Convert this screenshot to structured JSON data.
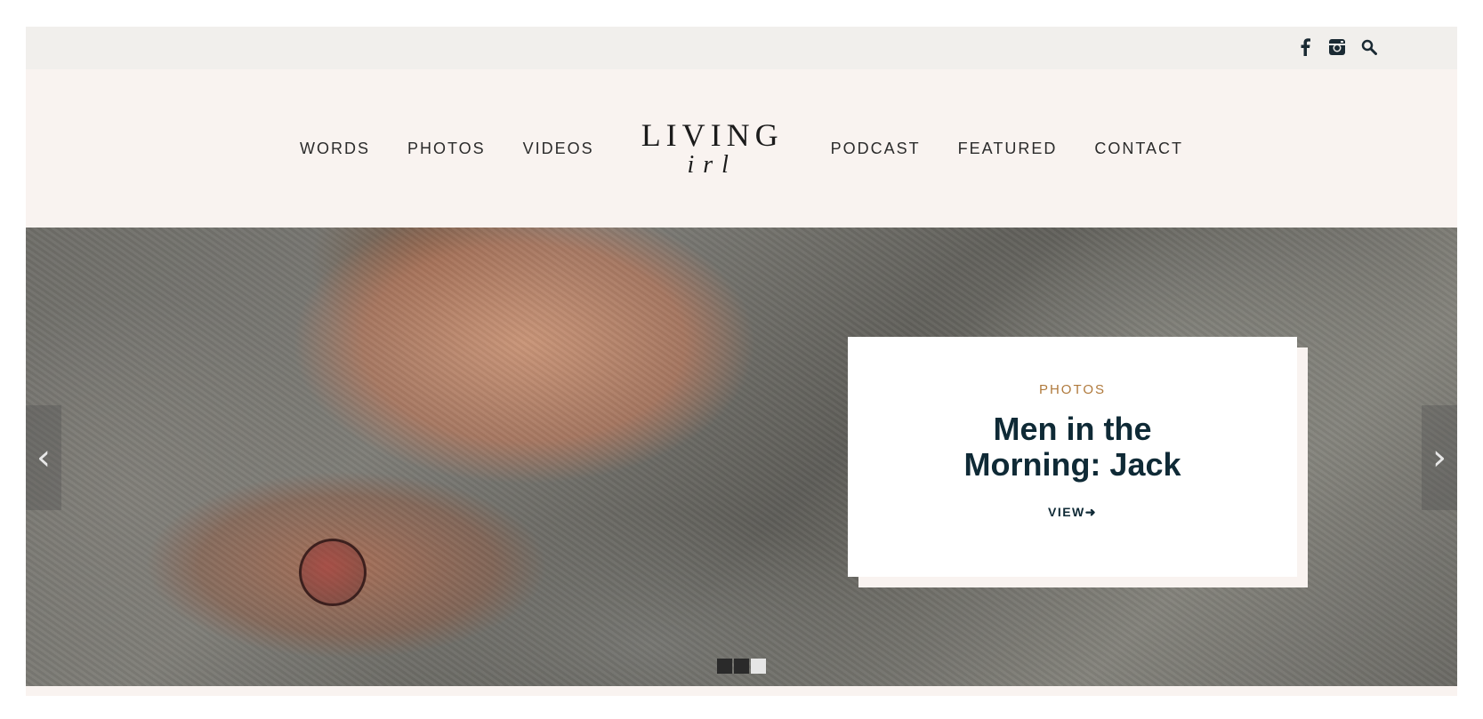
{
  "social": {
    "icons": [
      "facebook-icon",
      "instagram-icon",
      "search-icon"
    ]
  },
  "nav": {
    "left": [
      "WORDS",
      "PHOTOS",
      "VIDEOS"
    ],
    "right": [
      "PODCAST",
      "FEATURED",
      "CONTACT"
    ]
  },
  "logo": {
    "line1": "LIVING",
    "line2": "irl"
  },
  "hero": {
    "category": "PHOTOS",
    "title_line1": "Men in the",
    "title_line2": "Morning: Jack",
    "view_label": "VIEW➜",
    "prev_arrow": "‹",
    "next_arrow": "›",
    "slides_total": 3,
    "active_slide": 3
  },
  "colors": {
    "topbar": "#f1efec",
    "header": "#f9f3f0",
    "accent": "#b07a3d",
    "title": "#0f2a36"
  }
}
